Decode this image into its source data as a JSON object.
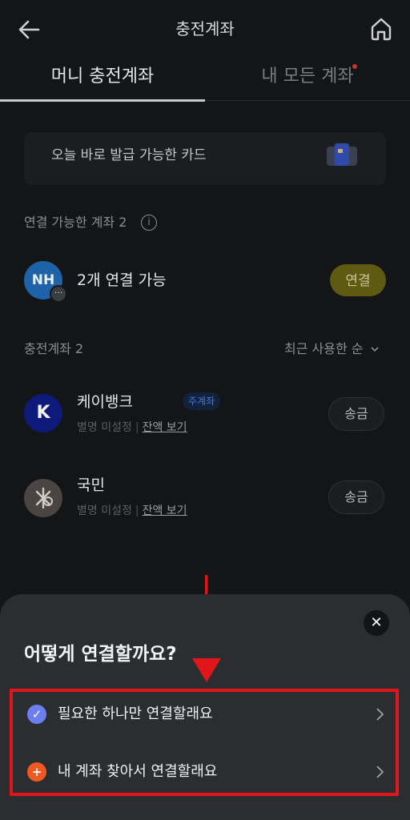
{
  "header": {
    "title": "충전계좌",
    "back_icon": "arrow-left-icon",
    "home_icon": "home-icon"
  },
  "tabs": [
    {
      "label": "머니 충전계좌",
      "active": true
    },
    {
      "label": "내 모든 계좌",
      "active": false,
      "has_dot": true
    }
  ],
  "banner": {
    "text": "오늘 바로 발급 가능한 카드",
    "icon": "card-icon"
  },
  "connectable": {
    "label": "연결 가능한 계좌 2",
    "info_icon": "i",
    "item": {
      "logo": "NH",
      "badge": "···",
      "text": "2개 연결 가능",
      "button": "연결"
    }
  },
  "charge_accounts": {
    "label": "충전계좌 2",
    "sort_label": "최근 사용한 순",
    "items": [
      {
        "logo": "K",
        "name": "케이뱅크",
        "badge": "주계좌",
        "nickname": "별명 미설정",
        "separator": "|",
        "balance_link": "잔액 보기",
        "button": "송금"
      },
      {
        "logo": "KB",
        "name": "국민",
        "nickname": "별명 미설정",
        "separator": "|",
        "balance_link": "잔액 보기",
        "button": "송금"
      }
    ]
  },
  "sheet": {
    "title": "어떻게 연결할까요?",
    "close_label": "✕",
    "options": [
      {
        "icon": "✓",
        "label": "필요한 하나만 연결할래요"
      },
      {
        "icon": "+",
        "label": "내 계좌 찾아서 연결할래요"
      }
    ]
  },
  "colors": {
    "annotation_red": "#e0161b",
    "connect_yellow": "#5e5a12",
    "check_blue": "#6d7ff0",
    "plus_orange": "#f05a22"
  }
}
